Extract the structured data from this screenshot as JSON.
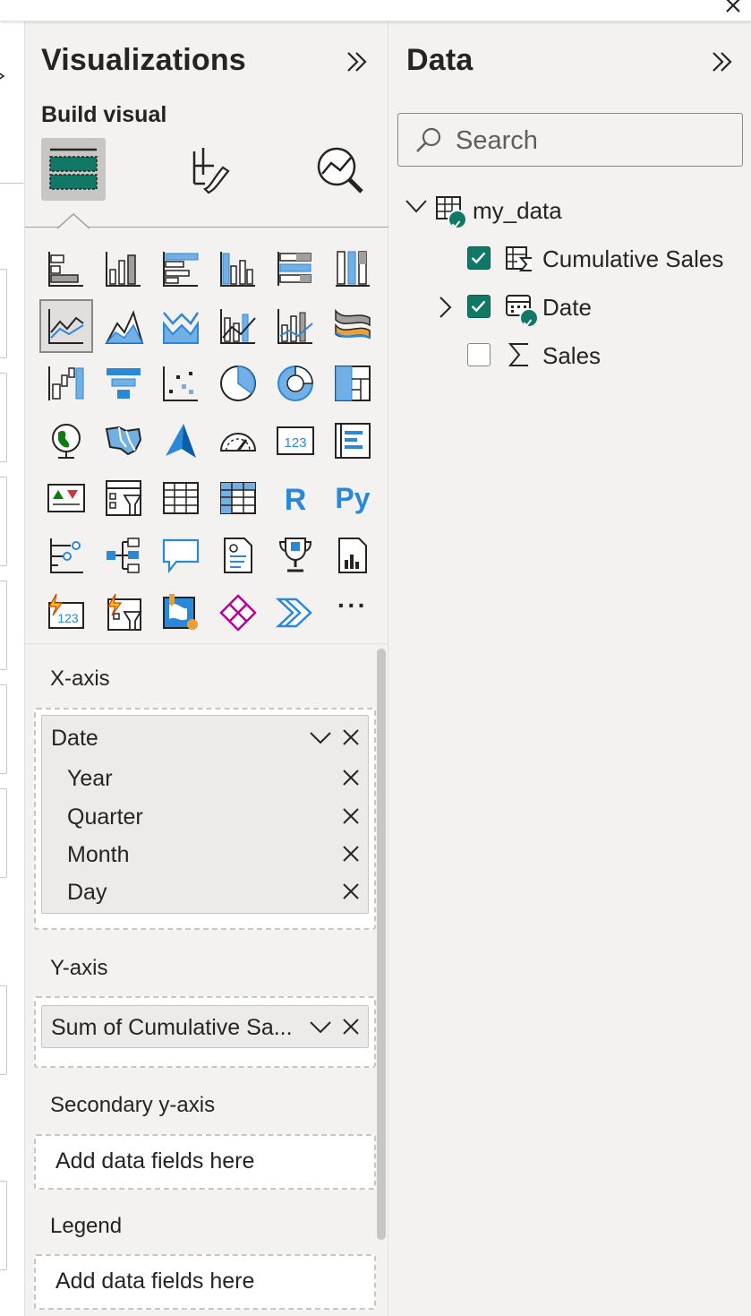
{
  "visualizations": {
    "title": "Visualizations",
    "build_visual_label": "Build visual",
    "tabs": [
      {
        "name": "build-visual-tab",
        "icon": "table-build-icon",
        "active": true
      },
      {
        "name": "format-visual-tab",
        "icon": "format-brush-icon",
        "active": false
      },
      {
        "name": "analytics-tab",
        "icon": "analytics-magnify-icon",
        "active": false
      }
    ],
    "icons": [
      [
        "stacked-bar-chart-icon",
        "stacked-column-chart-icon",
        "clustered-bar-chart-icon",
        "clustered-column-chart-icon",
        "100-stacked-bar-chart-icon",
        "100-stacked-column-chart-icon"
      ],
      [
        "line-chart-icon",
        "area-chart-icon",
        "stacked-area-chart-icon",
        "line-and-stacked-column-chart-icon",
        "line-and-clustered-column-chart-icon",
        "ribbon-chart-icon"
      ],
      [
        "waterfall-chart-icon",
        "funnel-chart-icon",
        "scatter-chart-icon",
        "pie-chart-icon",
        "donut-chart-icon",
        "treemap-icon"
      ],
      [
        "map-icon",
        "filled-map-icon",
        "azure-map-icon",
        "gauge-icon",
        "card-icon",
        "multi-row-card-icon"
      ],
      [
        "kpi-icon",
        "slicer-icon",
        "table-icon",
        "matrix-icon",
        "r-script-visual-icon",
        "python-visual-icon"
      ],
      [
        "key-influencers-icon",
        "decomposition-tree-icon",
        "qa-icon",
        "smart-narrative-icon",
        "metrics-icon",
        "paginated-report-icon"
      ],
      [
        "power-automate-card-icon",
        "power-automate-slicer-icon",
        "arcgis-map-icon",
        "power-apps-icon",
        "power-automate-icon",
        "more-visuals-icon"
      ]
    ],
    "r_text": "R",
    "py_text": "Py",
    "card_text": "123",
    "more_text": "···",
    "wells": {
      "x_axis": {
        "label": "X-axis",
        "field": "Date",
        "subfields": [
          "Year",
          "Quarter",
          "Month",
          "Day"
        ]
      },
      "y_axis": {
        "label": "Y-axis",
        "field": "Sum of Cumulative Sa..."
      },
      "secondary_y_axis": {
        "label": "Secondary y-axis",
        "placeholder": "Add data fields here"
      },
      "legend": {
        "label": "Legend",
        "placeholder": "Add data fields here"
      }
    }
  },
  "data_pane": {
    "title": "Data",
    "search_placeholder": "Search",
    "table_name": "my_data",
    "fields": [
      {
        "label": "Cumulative Sales",
        "checked": true,
        "icon": "calculated-measure-icon"
      },
      {
        "label": "Date",
        "checked": true,
        "icon": "calendar-icon",
        "expandable": true
      },
      {
        "label": "Sales",
        "checked": false,
        "icon": "sigma-icon"
      }
    ]
  },
  "colors": {
    "accent_green": "#117865",
    "chart_blue": "#2b88d8",
    "light_blue": "#71afe5",
    "pane_bg": "#f3f2f1"
  }
}
